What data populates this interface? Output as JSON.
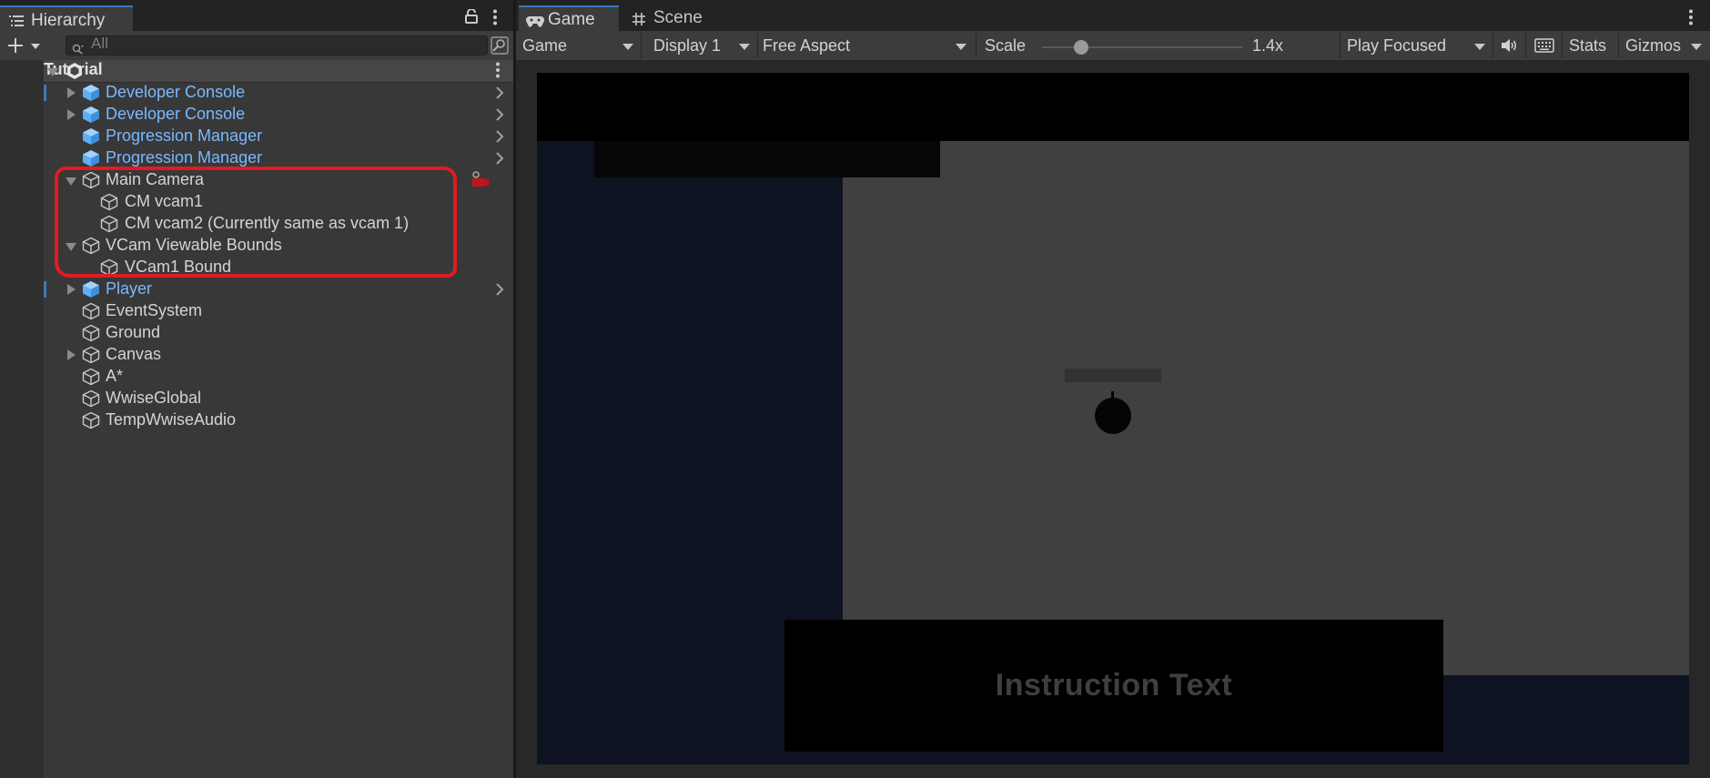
{
  "hierarchy": {
    "tab_title": "Hierarchy",
    "search_placeholder": "All",
    "scene_name": "Tutorial",
    "items": [
      {
        "label": "Developer Console",
        "color": "blue",
        "expand": "collapsed",
        "prefab": true,
        "depth": 0
      },
      {
        "label": "Developer Console",
        "color": "blue",
        "expand": "collapsed",
        "prefab": true,
        "depth": 0
      },
      {
        "label": "Progression Manager",
        "color": "blue",
        "expand": "none",
        "prefab": true,
        "depth": 0
      },
      {
        "label": "Progression Manager",
        "color": "blue",
        "expand": "none",
        "prefab": true,
        "depth": 0
      },
      {
        "label": "Main Camera",
        "color": "white",
        "expand": "expanded",
        "prefab": false,
        "depth": 0
      },
      {
        "label": "CM vcam1",
        "color": "white",
        "expand": "none",
        "prefab": false,
        "depth": 1
      },
      {
        "label": "CM vcam2 (Currently same as vcam 1)",
        "color": "white",
        "expand": "none",
        "prefab": false,
        "depth": 1
      },
      {
        "label": "VCam Viewable Bounds",
        "color": "white",
        "expand": "expanded",
        "prefab": false,
        "depth": 0
      },
      {
        "label": "VCam1 Bound",
        "color": "white",
        "expand": "none",
        "prefab": false,
        "depth": 1
      },
      {
        "label": "Player",
        "color": "blue",
        "expand": "collapsed",
        "prefab": true,
        "depth": 0
      },
      {
        "label": "EventSystem",
        "color": "white",
        "expand": "none",
        "prefab": false,
        "depth": 0
      },
      {
        "label": "Ground",
        "color": "white",
        "expand": "none",
        "prefab": false,
        "depth": 0
      },
      {
        "label": "Canvas",
        "color": "white",
        "expand": "collapsed",
        "prefab": false,
        "depth": 0
      },
      {
        "label": "A*",
        "color": "white",
        "expand": "none",
        "prefab": false,
        "depth": 0
      },
      {
        "label": "WwiseGlobal",
        "color": "white",
        "expand": "none",
        "prefab": false,
        "depth": 0
      },
      {
        "label": "TempWwiseAudio",
        "color": "white",
        "expand": "none",
        "prefab": false,
        "depth": 0
      }
    ]
  },
  "tabs": {
    "game": "Game",
    "scene": "Scene"
  },
  "game_toolbar": {
    "view_mode": "Game",
    "display": "Display 1",
    "aspect": "Free Aspect",
    "scale_label": "Scale",
    "scale_value": "1.4x",
    "play_mode": "Play Focused",
    "stats": "Stats",
    "gizmos": "Gizmos"
  },
  "game_view": {
    "instruction_text": "Instruction Text"
  },
  "colors": {
    "accent": "#3a79bb",
    "prefab_text": "#7ab8ff",
    "highlight": "#e01b24"
  }
}
